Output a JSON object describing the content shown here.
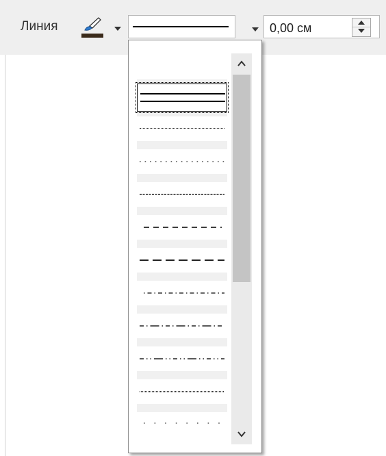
{
  "toolbar": {
    "line_label": "Линия",
    "line_color_icon": "line-color-brush-icon",
    "line_color_value": "#3a2a1a",
    "line_width_value": "0,00 см"
  },
  "line_style_list": {
    "selected_index": 0,
    "items": [
      {
        "style": "double-solid"
      },
      {
        "style": "fine-dotted"
      },
      {
        "style": "dotted"
      },
      {
        "style": "fine-dashed"
      },
      {
        "style": "dashed"
      },
      {
        "style": "long-dash"
      },
      {
        "style": "dash-dot"
      },
      {
        "style": "long-dash-dot"
      },
      {
        "style": "dash-dot-dot"
      },
      {
        "style": "ultrafine-dotted"
      },
      {
        "style": "sparse-dotted"
      }
    ]
  }
}
